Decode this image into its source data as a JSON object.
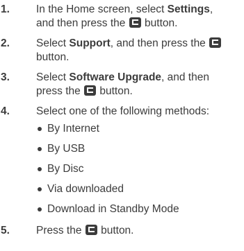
{
  "steps": [
    {
      "number": "1.",
      "line1_a": "In the Home screen, select ",
      "line1_bold": "Settings",
      "line1_b": ",",
      "line2_a": "and then press the ",
      "line2_b": " button."
    },
    {
      "number": "2.",
      "line1_a": "Select ",
      "line1_bold": "Support",
      "line1_b": ", and then press the ",
      "line2_a": "button."
    },
    {
      "number": "3.",
      "line1_a": "Select ",
      "line1_bold": "Software Upgrade",
      "line1_b": ", and then",
      "line2_a": "press the ",
      "line2_b": " button."
    },
    {
      "number": "4.",
      "line1_a": "Select one of the following methods:",
      "methods": [
        "By Internet",
        "By USB",
        "By Disc",
        "Via downloaded",
        "Download in Standby Mode"
      ]
    },
    {
      "number": "5.",
      "line1_a": "Press the ",
      "line1_b": " button."
    }
  ],
  "icon_name": "enter-button-icon",
  "text_color": "#3c3c3c"
}
